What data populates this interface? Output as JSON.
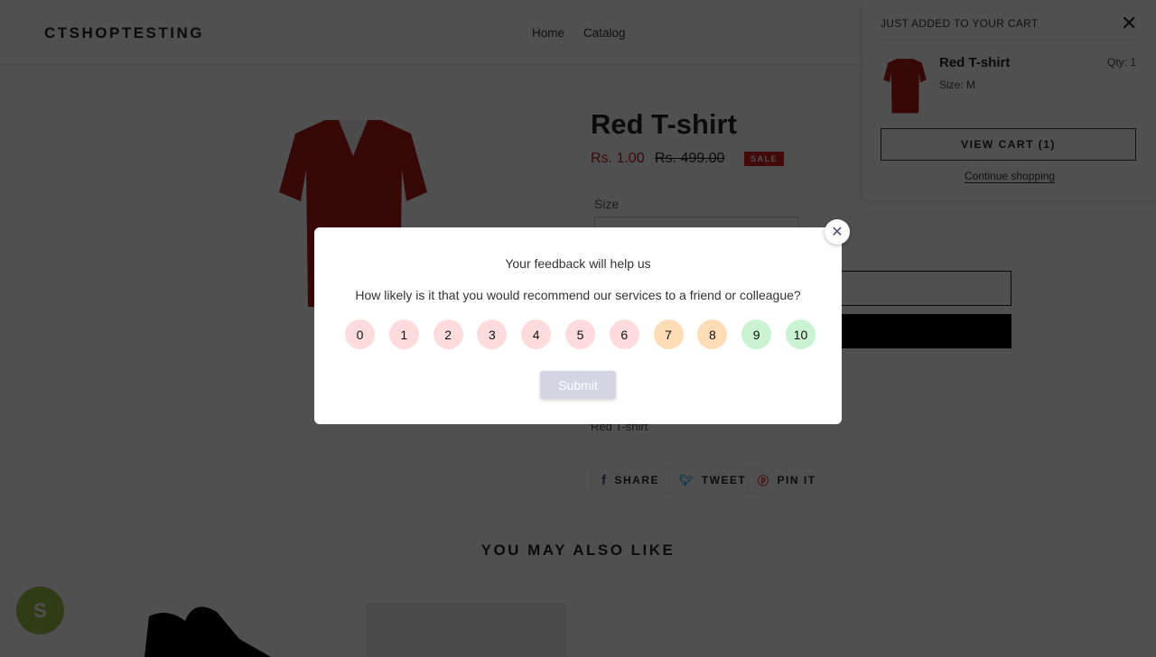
{
  "header": {
    "logo": "CTSHOPTESTING",
    "nav": [
      "Home",
      "Catalog"
    ]
  },
  "product": {
    "title": "Red T-shirt",
    "price": "Rs. 1.00",
    "compare_price": "Rs. 499.00",
    "badge": "SALE",
    "size_label": "Size",
    "description": "Red T-shirt",
    "share": [
      {
        "icon": "facebook-icon",
        "label": "SHARE",
        "color": "#3b5998"
      },
      {
        "icon": "twitter-icon",
        "label": "TWEET",
        "color": "#00aced"
      },
      {
        "icon": "pinterest-icon",
        "label": "PIN IT",
        "color": "#cb2127"
      }
    ]
  },
  "related": {
    "heading": "YOU MAY ALSO LIKE"
  },
  "cart_popup": {
    "heading": "JUST ADDED TO YOUR CART",
    "item_name": "Red T-shirt",
    "size": "Size: M",
    "qty": "Qty: 1",
    "view_cart": "VIEW CART (1)",
    "continue": "Continue shopping"
  },
  "feedback_modal": {
    "title": "Your feedback will help us",
    "question": "How likely is it that you would recommend our services to a friend or colleague?",
    "scores": [
      {
        "label": "0",
        "color": "#fedcdc"
      },
      {
        "label": "1",
        "color": "#fedcdc"
      },
      {
        "label": "2",
        "color": "#fedcdc"
      },
      {
        "label": "3",
        "color": "#fedcdc"
      },
      {
        "label": "4",
        "color": "#fedcdc"
      },
      {
        "label": "5",
        "color": "#fedcdc"
      },
      {
        "label": "6",
        "color": "#fedcdc"
      },
      {
        "label": "7",
        "color": "#fedcb5"
      },
      {
        "label": "8",
        "color": "#fedcb5"
      },
      {
        "label": "9",
        "color": "#c9f3d3"
      },
      {
        "label": "10",
        "color": "#c9f3d3"
      }
    ],
    "submit": "Submit"
  }
}
